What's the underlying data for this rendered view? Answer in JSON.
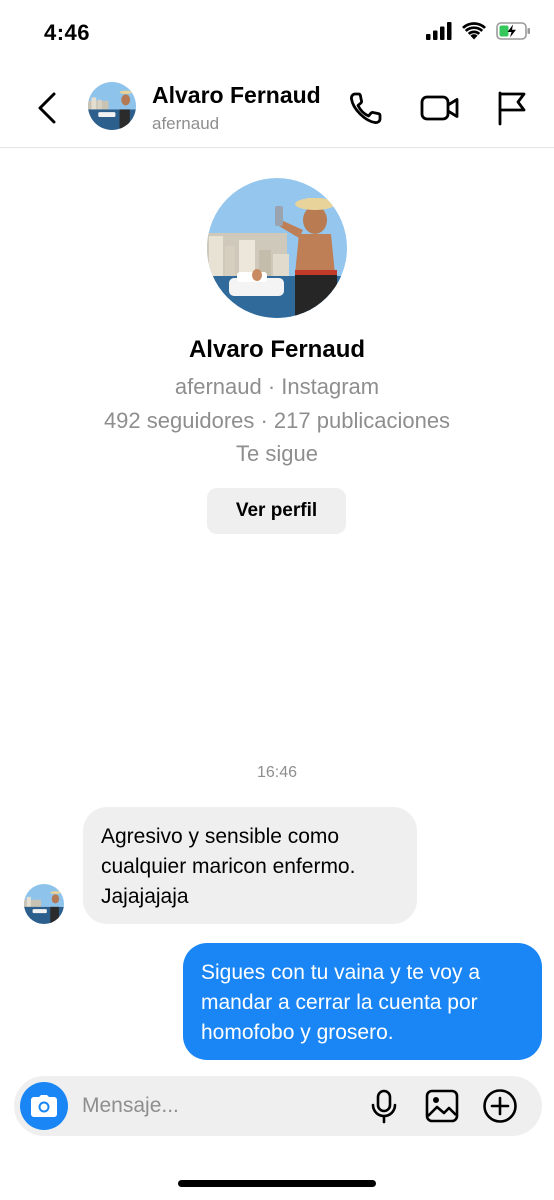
{
  "status_bar": {
    "time": "4:46"
  },
  "header": {
    "name": "Alvaro Fernaud",
    "username": "afernaud",
    "icons": [
      "chevron-left-icon",
      "phone-icon",
      "video-icon",
      "flag-icon"
    ]
  },
  "profile": {
    "name": "Alvaro Fernaud",
    "source": "afernaud · Instagram",
    "stats": "492 seguidores · 217 publicaciones",
    "follow_status": "Te sigue",
    "view_profile_label": "Ver perfil"
  },
  "thread": {
    "timestamp": "16:46",
    "messages": [
      {
        "direction": "incoming",
        "lines": [
          "Agresivo y sensible como",
          "cualquier maricon enfermo.",
          "Jajajajaja"
        ]
      },
      {
        "direction": "outgoing",
        "lines": [
          "Sigues con tu vaina y te voy a",
          "mandar a cerrar la cuenta por",
          "homofobo y grosero."
        ]
      }
    ]
  },
  "composer": {
    "placeholder": "Mensaje...",
    "icons": [
      "camera-icon",
      "microphone-icon",
      "gallery-icon",
      "add-icon"
    ]
  },
  "colors": {
    "accent": "#1a86f5",
    "incoming_bubble": "#efefef",
    "secondary_text": "#8e8e8e"
  }
}
